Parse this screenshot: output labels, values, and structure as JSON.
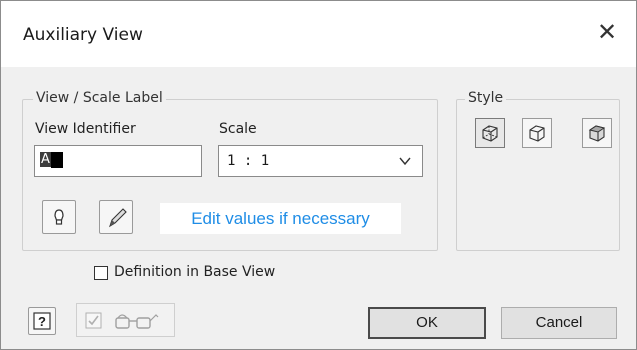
{
  "dialog": {
    "title": "Auxiliary View",
    "close_glyph": "✕"
  },
  "view_scale": {
    "group_label": "View / Scale Label",
    "identifier_label": "View Identifier",
    "identifier_value": "A",
    "scale_label": "Scale",
    "scale_value": "1 : 1",
    "visibility_icon": "lightbulb-icon",
    "edit_icon": "pencil-icon",
    "hint": "Edit values if necessary"
  },
  "style": {
    "group_label": "Style",
    "buttons": [
      {
        "name": "hidden-line-icon",
        "active": true
      },
      {
        "name": "hidden-line-removed-icon",
        "active": false
      },
      {
        "name": "shaded-icon",
        "active": false
      }
    ]
  },
  "definition_checkbox": {
    "label": "Definition in Base View",
    "checked": false
  },
  "footer": {
    "help_icon": "help-icon",
    "preview_icon": "preview-glasses-icon",
    "ok_label": "OK",
    "cancel_label": "Cancel"
  }
}
